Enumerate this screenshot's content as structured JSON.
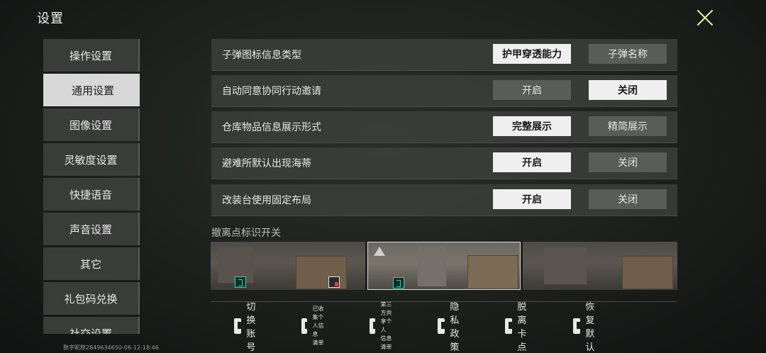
{
  "header": {
    "title": "设置"
  },
  "sidebar": {
    "items": [
      {
        "label": "操作设置",
        "active": false
      },
      {
        "label": "通用设置",
        "active": true
      },
      {
        "label": "图像设置",
        "active": false
      },
      {
        "label": "灵敏度设置",
        "active": false
      },
      {
        "label": "快捷语音",
        "active": false
      },
      {
        "label": "声音设置",
        "active": false
      },
      {
        "label": "其它",
        "active": false
      },
      {
        "label": "礼包码兑换",
        "active": false
      },
      {
        "label": "社交设置",
        "active": false
      }
    ]
  },
  "settings": {
    "rows": [
      {
        "label": "子弹图标信息类型",
        "option_a": "护甲穿透能力",
        "option_b": "子弹名称",
        "selected": "a"
      },
      {
        "label": "自动同意协同行动邀请",
        "option_a": "开启",
        "option_b": "关闭",
        "selected": "b"
      },
      {
        "label": "仓库物品信息展示形式",
        "option_a": "完整展示",
        "option_b": "精简展示",
        "selected": "a"
      },
      {
        "label": "避难所默认出现海蒂",
        "option_a": "开启",
        "option_b": "关闭",
        "selected": "a"
      },
      {
        "label": "改装台使用固定布局",
        "option_a": "开启",
        "option_b": "关闭",
        "selected": "a"
      }
    ],
    "extraction_section_title": "撤离点标识开关",
    "extraction_selected_index": 1
  },
  "bottom_bar": {
    "items": [
      {
        "label": "切换账号",
        "icon": "account-switch-icon"
      },
      {
        "label_line1": "已收集个人信息",
        "label_line2": "清单",
        "icon": "document-icon"
      },
      {
        "label_line1": "第三方共享个人",
        "label_line2": "信息清单",
        "icon": "document-icon"
      },
      {
        "label": "隐私政策",
        "icon": "privacy-policy-icon"
      },
      {
        "label": "脱离卡点",
        "icon": "running-figure-icon"
      },
      {
        "label": "恢复默认",
        "icon": "restore-icon"
      }
    ]
  },
  "footer": {
    "id_text": "数字昵称2849634650-06-12-18:46"
  },
  "colors": {
    "selected_bg": "#efefef",
    "unselected_bg": "#5a5c5a",
    "accent_teal": "#2fd5b2",
    "close_icon": "#d9f0a8"
  }
}
